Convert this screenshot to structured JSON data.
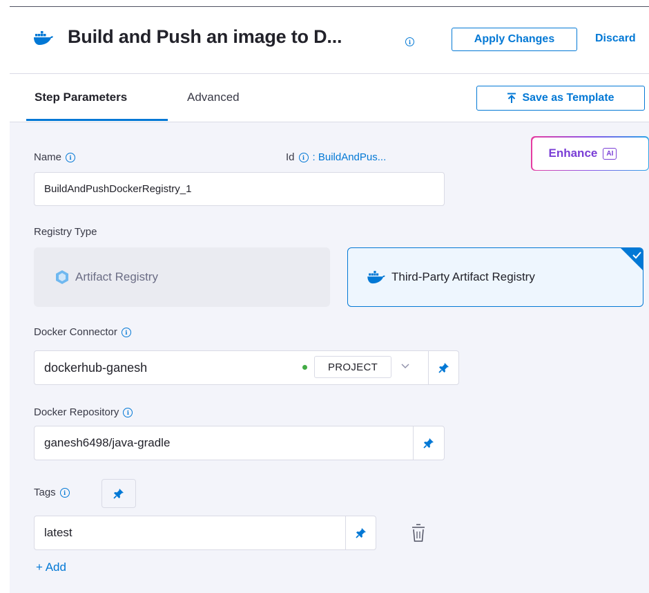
{
  "header": {
    "title": "Build and Push an image to D...",
    "apply_label": "Apply Changes",
    "discard_label": "Discard"
  },
  "tabs": [
    {
      "label": "Step Parameters",
      "active": true
    },
    {
      "label": "Advanced",
      "active": false
    }
  ],
  "save_template_label": "Save as Template",
  "enhance": {
    "label": "Enhance",
    "badge": "AI"
  },
  "name_field": {
    "label": "Name",
    "value": "BuildAndPushDockerRegistry_1"
  },
  "id_field": {
    "label": "Id",
    "value": ": BuildAndPus..."
  },
  "registry_type": {
    "label": "Registry Type",
    "options": [
      {
        "label": "Artifact Registry",
        "selected": false
      },
      {
        "label": "Third-Party Artifact Registry",
        "selected": true
      }
    ]
  },
  "docker_connector": {
    "label": "Docker Connector",
    "value": "dockerhub-ganesh",
    "scope": "PROJECT",
    "status": "connected"
  },
  "docker_repository": {
    "label": "Docker Repository",
    "value": "ganesh6498/java-gradle"
  },
  "tags": {
    "label": "Tags",
    "items": [
      "latest"
    ],
    "add_label": "+ Add"
  },
  "colors": {
    "accent": "#0278d5",
    "panel_bg": "#f3f4fa",
    "enhance_purple": "#7a3ed6",
    "status_green": "#42ab45"
  },
  "icons": [
    "docker-icon",
    "info-icon",
    "upload-icon",
    "hexagon-icon",
    "pin-icon",
    "chevron-down-icon",
    "trash-icon",
    "check-icon"
  ]
}
